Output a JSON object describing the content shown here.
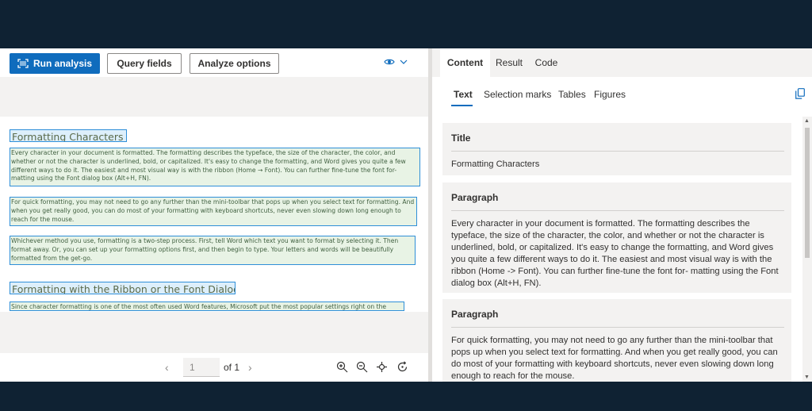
{
  "toolbar": {
    "run_label": "Run analysis",
    "query_label": "Query fields",
    "analyze_label": "Analyze options"
  },
  "document": {
    "heading1": "Formatting Characters",
    "para1": "Every character in your document is formatted. The formatting describes the typeface, the size of the character, the color, and whether or not the character is underlined, bold, or capitalized. It's easy to change the formatting, and Word gives you quite a few different ways to do it. The easiest and most visual way is with the ribbon (Home → Font). You can further fine-tune the font for-matting using the Font dialog box (Alt+H, FN).",
    "para2": "For quick formatting, you may not need to go any further than the mini-toolbar that pops up when you select text for formatting. And when you get really good, you can do most of your formatting with keyboard shortcuts, never even slowing down long enough to reach for the mouse.",
    "para3": "Whichever method you use, formatting is a two-step process. First, tell Word which text you want to format by selecting it. Then format away. Or, you can set up your formatting options first, and then begin to type. Your letters and words will be beautifully formatted from the get-go.",
    "heading2": "Formatting with the Ribbon or the Font Dialog Box",
    "para4": "Since character formatting is one of the most often used Word features, Microsoft put the most popular settings right on the"
  },
  "pager": {
    "page_value": "1",
    "of_label": "of 1"
  },
  "tabs": [
    "Content",
    "Result",
    "Code"
  ],
  "subtabs": [
    "Text",
    "Selection marks",
    "Tables",
    "Figures"
  ],
  "cards": [
    {
      "heading": "Title",
      "body": "Formatting Characters"
    },
    {
      "heading": "Paragraph",
      "body": "Every character in your document is formatted. The formatting describes the typeface, the size of the character, the color, and whether or not the character is underlined, bold, or capitalized. It's easy to change the formatting, and Word gives you quite a few different ways to do it. The easiest and most visual way is with the ribbon (Home -> Font). You can further fine-tune the font for- matting using the Font dialog box (Alt+H, FN)."
    },
    {
      "heading": "Paragraph",
      "body": "For quick formatting, you may not need to go any further than the mini-toolbar that pops up when you select text for formatting. And when you get really good, you can do most of your formatting with keyboard shortcuts, never even slowing down long enough to reach for the mouse."
    }
  ],
  "colors": {
    "accent": "#0f6cbd",
    "highlight_border": "#2f8fd8",
    "frame": "#0f2233"
  },
  "icons": [
    "scan-icon",
    "eye-icon",
    "chevron-down-icon",
    "prev-page-icon",
    "next-page-icon",
    "zoom-in-icon",
    "zoom-out-icon",
    "fit-page-icon",
    "rotate-icon",
    "copy-icon"
  ]
}
